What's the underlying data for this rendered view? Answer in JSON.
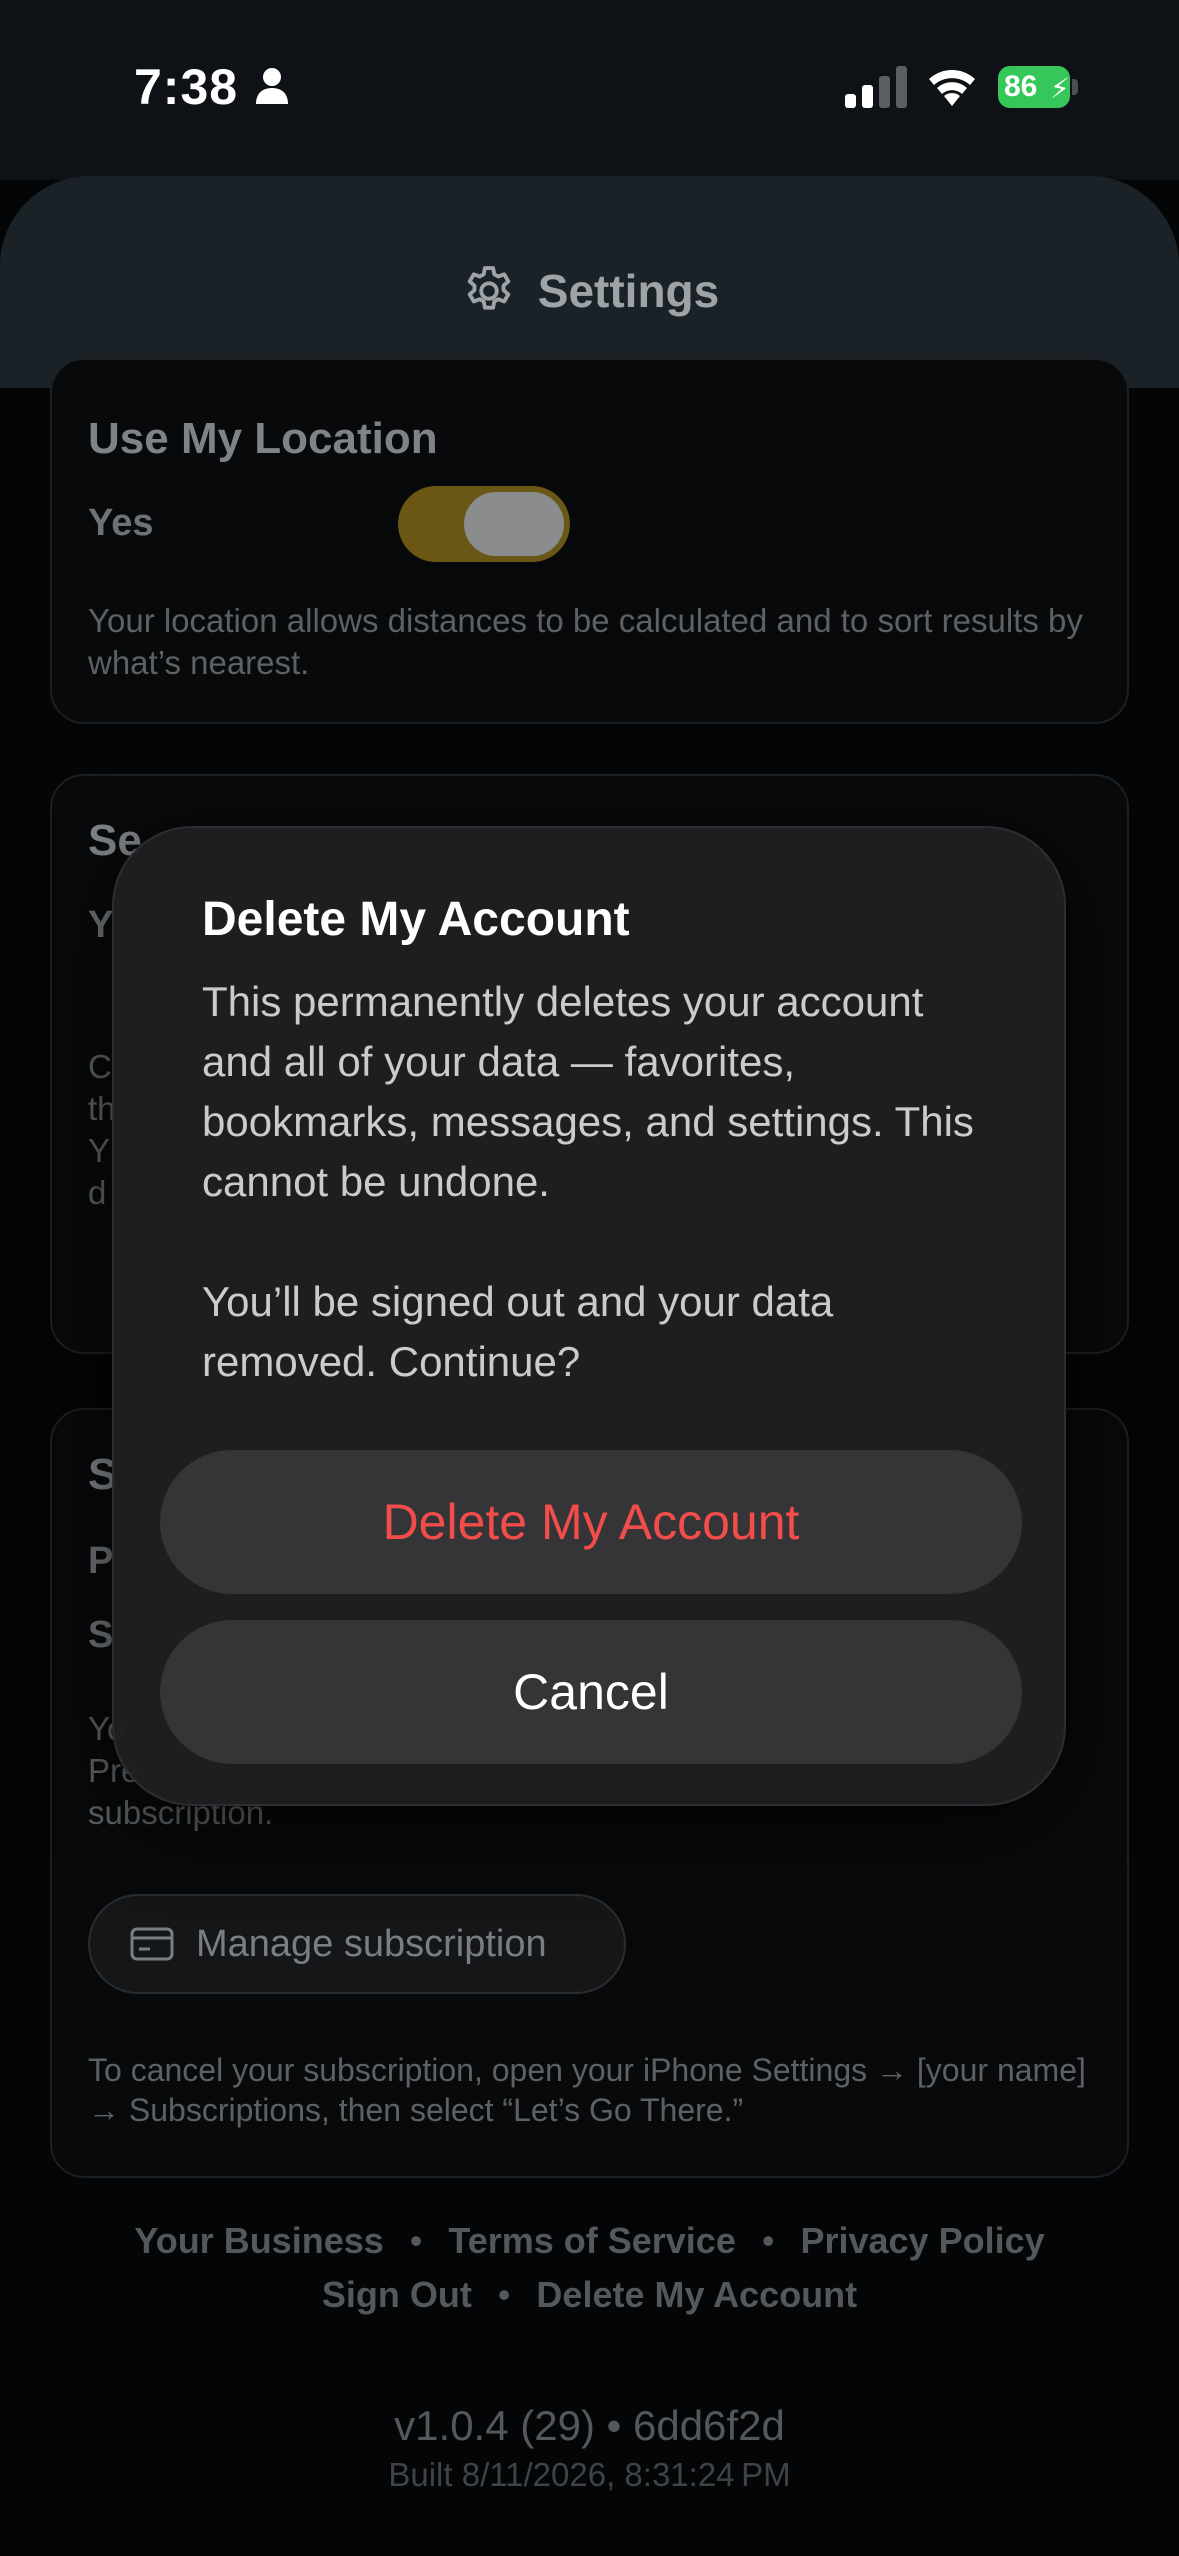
{
  "status_bar": {
    "time": "7:38",
    "battery": "86"
  },
  "header": {
    "title": "Settings"
  },
  "location_card": {
    "title": "Use My Location",
    "toggle_label": "Yes",
    "toggle_on": true,
    "description": "Your location allows distances to be calculated and to sort results by what’s nearest."
  },
  "card2": {
    "title_fragment": "Se",
    "row_fragment": "Y",
    "desc_fragments": [
      "C",
      "th",
      "Y",
      "d"
    ]
  },
  "card3": {
    "title_fragment": "S",
    "row1_fragment": "P",
    "row2_fragment": "S",
    "desc_lines": [
      "Yo",
      "Pre",
      "subscription."
    ],
    "manage_button": "Manage subscription",
    "cancel_note": "To cancel your subscription, open your iPhone Settings → [your name] → Subscriptions, then select “Let’s Go There.”"
  },
  "footer": {
    "links_row1": [
      "Your Business",
      "Terms of Service",
      "Privacy Policy"
    ],
    "links_row2": [
      "Sign Out",
      "Delete My Account"
    ],
    "separator": "•",
    "version": "v1.0.4 (29) • 6dd6f2d",
    "built": "Built 8/11/2026, 8:31:24 PM"
  },
  "dialog": {
    "title": "Delete My Account",
    "body": "This permanently deletes your account and all of your data — favorites, bookmarks, messages, and settings. This cannot be undone.\n\nYou’ll be signed out and your data removed. Continue?",
    "confirm_label": "Delete My Account",
    "cancel_label": "Cancel"
  },
  "colors": {
    "destructive": "#f24d4a",
    "toggle_on": "#6a5716",
    "battery": "#35c759"
  }
}
